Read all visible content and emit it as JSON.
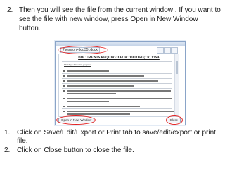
{
  "instruction": {
    "number": "2.",
    "text": "Then you will see the file from the current window . If you want to see the file with new window, press Open in New Window button."
  },
  "screenshot": {
    "filename": "?session=5qp35 .docx",
    "doc_title": "DOCUMENTS REQUIRED FOR TOURIST (TR) VISA",
    "section_label": "Holiday / Vacation purpose",
    "open_button": "Open in New Window",
    "close_button": "Close",
    "item_count_label": [
      "1.",
      "2.",
      "3.",
      "4.",
      "5.",
      "6.",
      "7.",
      "8.",
      "9."
    ]
  },
  "notes": [
    {
      "number": "1.",
      "text": "Click on Save/Edit/Export or Print tab to save/edit/export or print file."
    },
    {
      "number": "2.",
      "text": "Click on Close button to close the file."
    }
  ],
  "colors": {
    "highlight": "#e32020",
    "window_border": "#8aa4c8"
  }
}
